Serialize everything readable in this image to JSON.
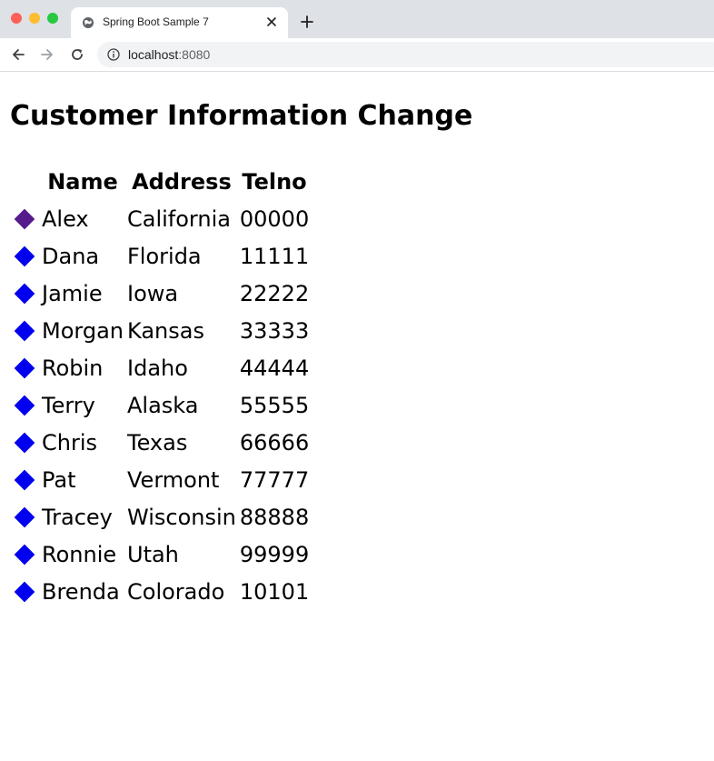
{
  "browser": {
    "tab_title": "Spring Boot Sample 7",
    "url_host": "localhost",
    "url_port": ":8080"
  },
  "page": {
    "title": "Customer Information Change",
    "columns": [
      "Name",
      "Address",
      "Telno"
    ],
    "rows": [
      {
        "name": "Alex",
        "address": "California",
        "telno": "00000",
        "selected": true
      },
      {
        "name": "Dana",
        "address": "Florida",
        "telno": "11111",
        "selected": false
      },
      {
        "name": "Jamie",
        "address": "Iowa",
        "telno": "22222",
        "selected": false
      },
      {
        "name": "Morgan",
        "address": "Kansas",
        "telno": "33333",
        "selected": false
      },
      {
        "name": "Robin",
        "address": "Idaho",
        "telno": "44444",
        "selected": false
      },
      {
        "name": "Terry",
        "address": "Alaska",
        "telno": "55555",
        "selected": false
      },
      {
        "name": "Chris",
        "address": "Texas",
        "telno": "66666",
        "selected": false
      },
      {
        "name": "Pat",
        "address": "Vermont",
        "telno": "77777",
        "selected": false
      },
      {
        "name": "Tracey",
        "address": "Wisconsin",
        "telno": "88888",
        "selected": false
      },
      {
        "name": "Ronnie",
        "address": "Utah",
        "telno": "99999",
        "selected": false
      },
      {
        "name": "Brenda",
        "address": "Colorado",
        "telno": "10101",
        "selected": false
      }
    ]
  },
  "colors": {
    "link": "#0000ee",
    "visited_link": "#551a8b"
  },
  "icons": {
    "row_marker": "diamond-icon"
  }
}
